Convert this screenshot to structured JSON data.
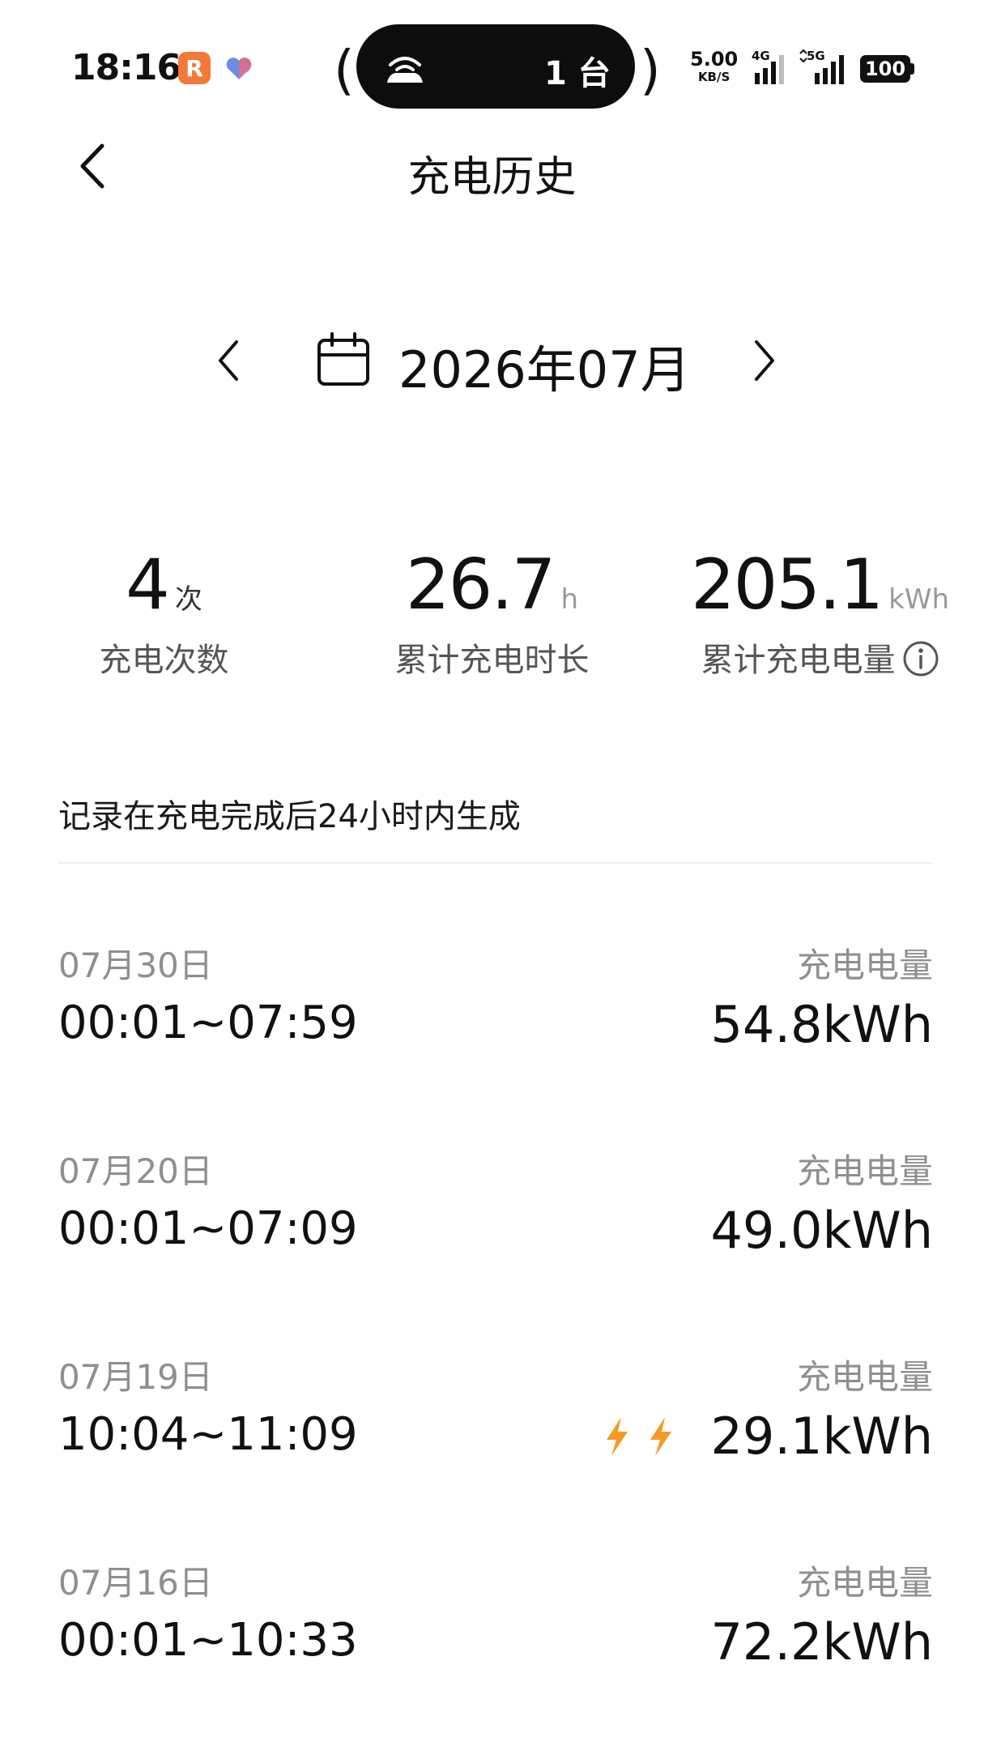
{
  "status_bar": {
    "time": "18:16",
    "app_badge": "R",
    "island_text": "1 台",
    "net_speed_value": "5.00",
    "net_speed_unit": "KB/S",
    "signal_1": "4G",
    "signal_2": "5G",
    "battery": "100"
  },
  "header": {
    "title": "充电历史"
  },
  "month_selector": {
    "label": "2026年07月"
  },
  "stats": [
    {
      "value": "4",
      "unit": "次",
      "label": "充电次数"
    },
    {
      "value": "26.7",
      "unit": "h",
      "label": "累计充电时长"
    },
    {
      "value": "205.1",
      "unit": "kWh",
      "label": "累计充电电量"
    }
  ],
  "note": "记录在充电完成后24小时内生成",
  "records": [
    {
      "date": "07月30日",
      "time": "00:01~07:59",
      "label": "充电电量",
      "value": "54.8kWh",
      "fast": false
    },
    {
      "date": "07月20日",
      "time": "00:01~07:09",
      "label": "充电电量",
      "value": "49.0kWh",
      "fast": false
    },
    {
      "date": "07月19日",
      "time": "10:04~11:09",
      "label": "充电电量",
      "value": "29.1kWh",
      "fast": true
    },
    {
      "date": "07月16日",
      "time": "00:01~10:33",
      "label": "充电电量",
      "value": "72.2kWh",
      "fast": false
    }
  ],
  "icons": {
    "back": "chevron-left-icon",
    "prev": "chevron-left-icon",
    "next": "chevron-right-icon",
    "calendar": "calendar-icon",
    "info": "info-icon",
    "fast_charge": "lightning-bolt-icon"
  },
  "colors": {
    "accent_orange": "#f59a23",
    "muted_text": "#8f8f8f"
  }
}
